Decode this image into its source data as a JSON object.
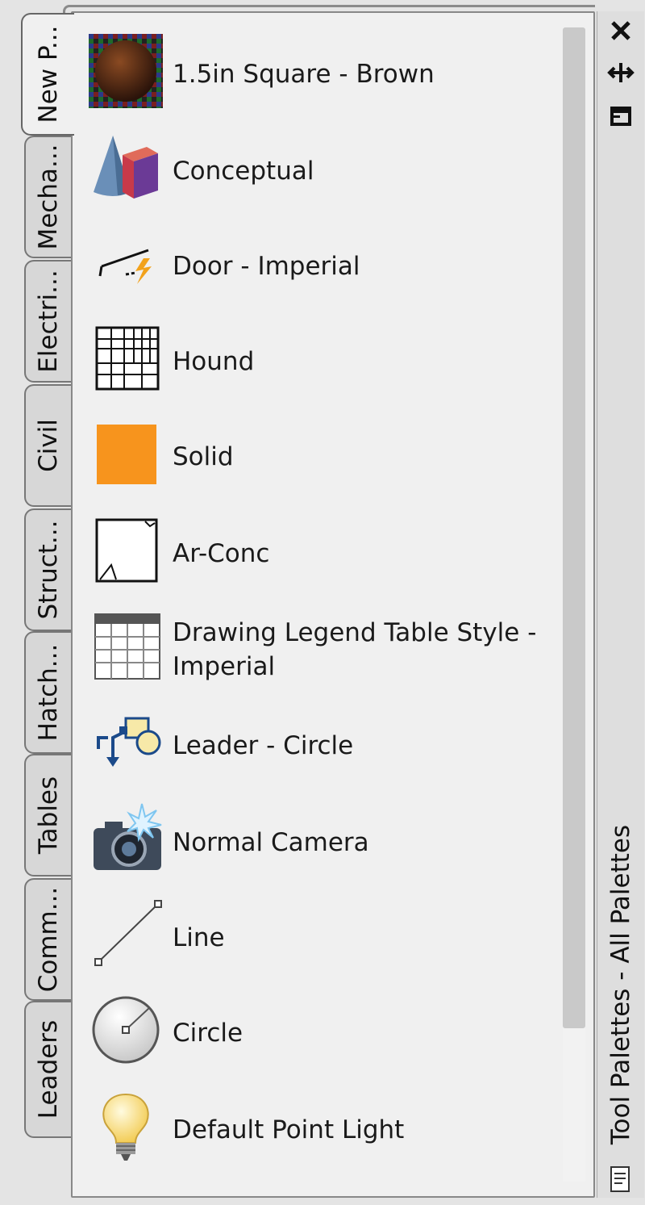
{
  "palette": {
    "title": "Tool Palettes - All Palettes",
    "tabs": [
      {
        "label": "New P...",
        "active": true
      },
      {
        "label": "Mecha...",
        "active": false
      },
      {
        "label": "Electri...",
        "active": false
      },
      {
        "label": "Civil",
        "active": false
      },
      {
        "label": "Struct...",
        "active": false
      },
      {
        "label": "Hatch...",
        "active": false
      },
      {
        "label": "Tables",
        "active": false
      },
      {
        "label": "Comm...",
        "active": false
      },
      {
        "label": "Leaders",
        "active": false
      }
    ],
    "items": [
      {
        "label": "1.5in Square - Brown",
        "icon": "material-brown-icon"
      },
      {
        "label": "Conceptual",
        "icon": "visual-style-conceptual-icon"
      },
      {
        "label": "Door - Imperial",
        "icon": "door-icon"
      },
      {
        "label": "Hound",
        "icon": "hatch-pattern-icon"
      },
      {
        "label": "Solid",
        "icon": "solid-fill-icon"
      },
      {
        "label": "Ar-Conc",
        "icon": "ar-conc-pattern-icon"
      },
      {
        "label": "Drawing Legend Table Style - Imperial",
        "icon": "table-icon"
      },
      {
        "label": "Leader - Circle",
        "icon": "leader-icon"
      },
      {
        "label": "Normal Camera",
        "icon": "camera-icon"
      },
      {
        "label": "Line",
        "icon": "line-icon"
      },
      {
        "label": "Circle",
        "icon": "circle-icon"
      },
      {
        "label": "Default Point Light",
        "icon": "light-bulb-icon"
      }
    ],
    "colors": {
      "solid_fill": "#f7941d",
      "panel_bg": "#f0f0f0",
      "scroll_thumb": "#c9c9c9"
    }
  }
}
